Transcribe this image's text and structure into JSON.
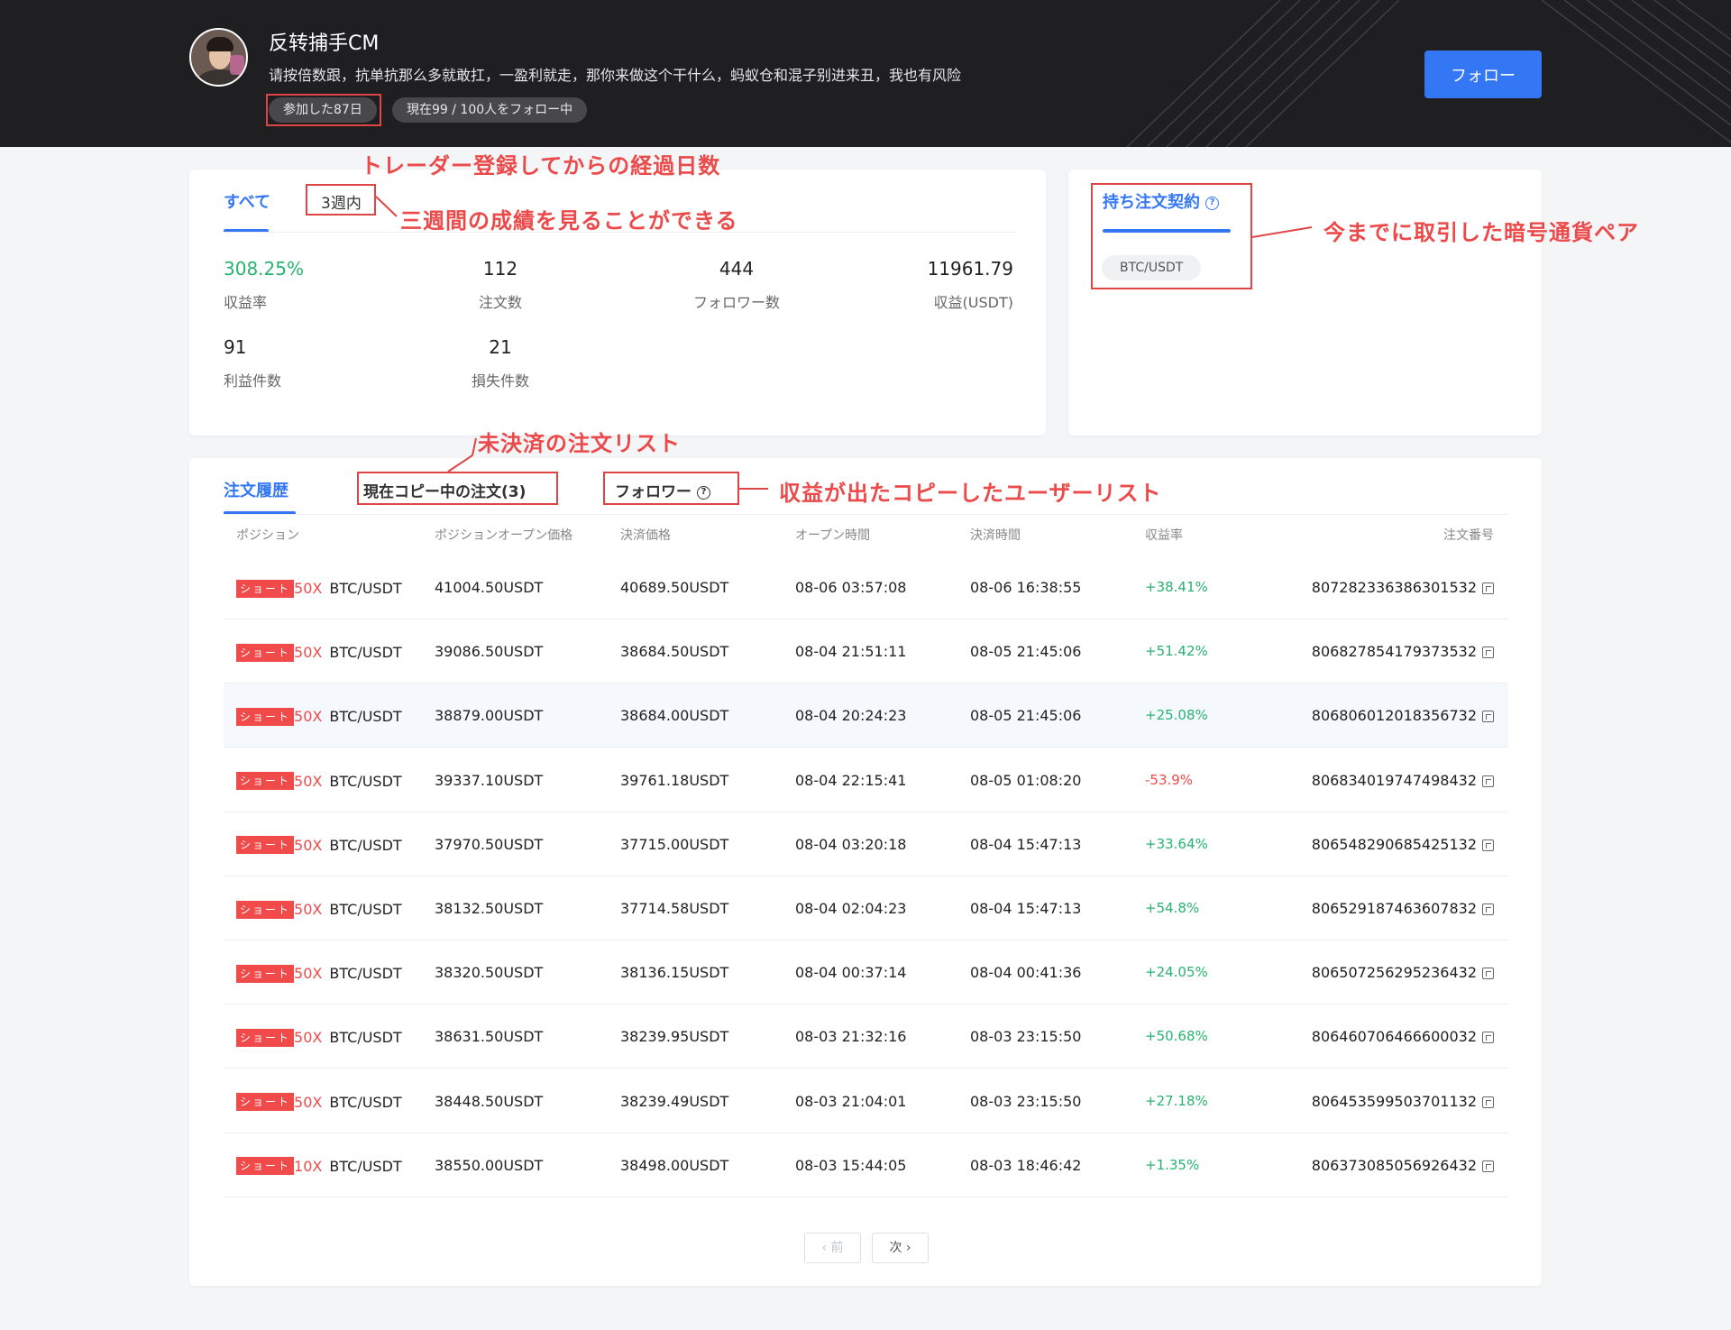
{
  "header": {
    "user_name": "反转捕手CM",
    "bio": "请按倍数跟，抗单抗那么多就敢扛，一盈利就走，那你来做这个干什么，蚂蚁仓和混子别进来丑，我也有风险",
    "tag_joined": "参加した87日",
    "tag_following": "現在99 / 100人をフォロー中",
    "follow_label": "フォロー"
  },
  "stats": {
    "tab_all": "すべて",
    "tab_3weeks": "3週内",
    "items": [
      {
        "value": "308.25%",
        "label": "収益率"
      },
      {
        "value": "112",
        "label": "注文数"
      },
      {
        "value": "444",
        "label": "フォロワー数"
      },
      {
        "value": "11961.79",
        "label": "収益(USDT)"
      },
      {
        "value": "91",
        "label": "利益件数"
      },
      {
        "value": "21",
        "label": "損失件数"
      }
    ]
  },
  "pairs": {
    "tab_label": "持ち注文契約",
    "chips": [
      "BTC/USDT"
    ]
  },
  "orders": {
    "tabs": [
      "注文履歴",
      "現在コピー中の注文(3)",
      "フォロワー"
    ],
    "columns": [
      "ポジション",
      "ポジションオープン価格",
      "決済価格",
      "オープン時間",
      "決済時間",
      "収益率",
      "注文番号"
    ],
    "rows": [
      {
        "side": "ショート",
        "leverage": "50X",
        "pair": "BTC/USDT",
        "open_price": "41004.50USDT",
        "close_price": "40689.50USDT",
        "open_time": "08-06 03:57:08",
        "close_time": "08-06 16:38:55",
        "pnl": "+38.41%",
        "order_no": "807282336386301532"
      },
      {
        "side": "ショート",
        "leverage": "50X",
        "pair": "BTC/USDT",
        "open_price": "39086.50USDT",
        "close_price": "38684.50USDT",
        "open_time": "08-04 21:51:11",
        "close_time": "08-05 21:45:06",
        "pnl": "+51.42%",
        "order_no": "806827854179373532"
      },
      {
        "side": "ショート",
        "leverage": "50X",
        "pair": "BTC/USDT",
        "open_price": "38879.00USDT",
        "close_price": "38684.00USDT",
        "open_time": "08-04 20:24:23",
        "close_time": "08-05 21:45:06",
        "pnl": "+25.08%",
        "order_no": "806806012018356732"
      },
      {
        "side": "ショート",
        "leverage": "50X",
        "pair": "BTC/USDT",
        "open_price": "39337.10USDT",
        "close_price": "39761.18USDT",
        "open_time": "08-04 22:15:41",
        "close_time": "08-05 01:08:20",
        "pnl": "-53.9%",
        "order_no": "806834019747498432"
      },
      {
        "side": "ショート",
        "leverage": "50X",
        "pair": "BTC/USDT",
        "open_price": "37970.50USDT",
        "close_price": "37715.00USDT",
        "open_time": "08-04 03:20:18",
        "close_time": "08-04 15:47:13",
        "pnl": "+33.64%",
        "order_no": "806548290685425132"
      },
      {
        "side": "ショート",
        "leverage": "50X",
        "pair": "BTC/USDT",
        "open_price": "38132.50USDT",
        "close_price": "37714.58USDT",
        "open_time": "08-04 02:04:23",
        "close_time": "08-04 15:47:13",
        "pnl": "+54.8%",
        "order_no": "806529187463607832"
      },
      {
        "side": "ショート",
        "leverage": "50X",
        "pair": "BTC/USDT",
        "open_price": "38320.50USDT",
        "close_price": "38136.15USDT",
        "open_time": "08-04 00:37:14",
        "close_time": "08-04 00:41:36",
        "pnl": "+24.05%",
        "order_no": "806507256295236432"
      },
      {
        "side": "ショート",
        "leverage": "50X",
        "pair": "BTC/USDT",
        "open_price": "38631.50USDT",
        "close_price": "38239.95USDT",
        "open_time": "08-03 21:32:16",
        "close_time": "08-03 23:15:50",
        "pnl": "+50.68%",
        "order_no": "806460706466600032"
      },
      {
        "side": "ショート",
        "leverage": "50X",
        "pair": "BTC/USDT",
        "open_price": "38448.50USDT",
        "close_price": "38239.49USDT",
        "open_time": "08-03 21:04:01",
        "close_time": "08-03 23:15:50",
        "pnl": "+27.18%",
        "order_no": "806453599503701132"
      },
      {
        "side": "ショート",
        "leverage": "10X",
        "pair": "BTC/USDT",
        "open_price": "38550.00USDT",
        "close_price": "38498.00USDT",
        "open_time": "08-03 15:44:05",
        "close_time": "08-03 18:46:42",
        "pnl": "+1.35%",
        "order_no": "806373085056926432"
      }
    ],
    "pager": {
      "prev": "‹ 前",
      "next": "次 ›"
    }
  },
  "annotations": {
    "days_since_registration": "トレーダー登録してからの経過日数",
    "three_week_results": "三週間の成績を見ることができる",
    "traded_pairs": "今までに取引した暗号通貨ペア",
    "open_orders": "未決済の注文リスト",
    "profitable_copiers": "収益が出たコピーしたユーザーリスト"
  },
  "colors": {
    "accent": "#3477f5",
    "profit": "#27b36f",
    "loss": "#f04a4a",
    "annotation": "#ec4a4a",
    "header_bg": "#1f1f22"
  }
}
